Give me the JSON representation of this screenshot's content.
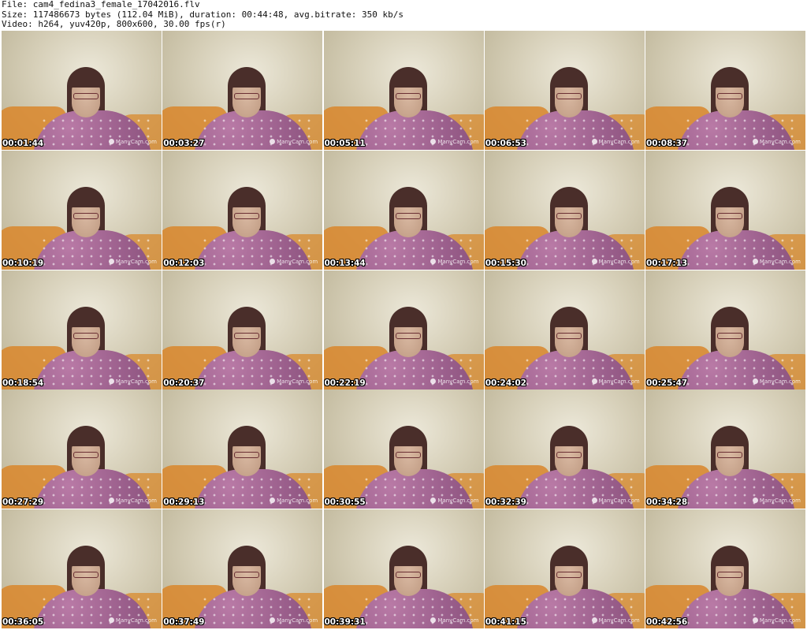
{
  "header": {
    "file_line": "File: cam4_fedina3_female_17042016.flv",
    "size_line": "Size: 117486673 bytes (112.04 MiB), duration: 00:44:48, avg.bitrate: 350 kb/s",
    "video_line": "Video: h264, yuv420p, 800x600, 30.00 fps(r)"
  },
  "watermark": "ManyCam.com",
  "thumbnails": [
    {
      "timestamp": "00:01:44"
    },
    {
      "timestamp": "00:03:27"
    },
    {
      "timestamp": "00:05:11"
    },
    {
      "timestamp": "00:06:53"
    },
    {
      "timestamp": "00:08:37"
    },
    {
      "timestamp": "00:10:19"
    },
    {
      "timestamp": "00:12:03"
    },
    {
      "timestamp": "00:13:44"
    },
    {
      "timestamp": "00:15:30"
    },
    {
      "timestamp": "00:17:13"
    },
    {
      "timestamp": "00:18:54"
    },
    {
      "timestamp": "00:20:37"
    },
    {
      "timestamp": "00:22:19"
    },
    {
      "timestamp": "00:24:02"
    },
    {
      "timestamp": "00:25:47"
    },
    {
      "timestamp": "00:27:29"
    },
    {
      "timestamp": "00:29:13"
    },
    {
      "timestamp": "00:30:55"
    },
    {
      "timestamp": "00:32:39"
    },
    {
      "timestamp": "00:34:28"
    },
    {
      "timestamp": "00:36:05"
    },
    {
      "timestamp": "00:37:49"
    },
    {
      "timestamp": "00:39:31"
    },
    {
      "timestamp": "00:41:15"
    },
    {
      "timestamp": "00:42:56"
    }
  ]
}
